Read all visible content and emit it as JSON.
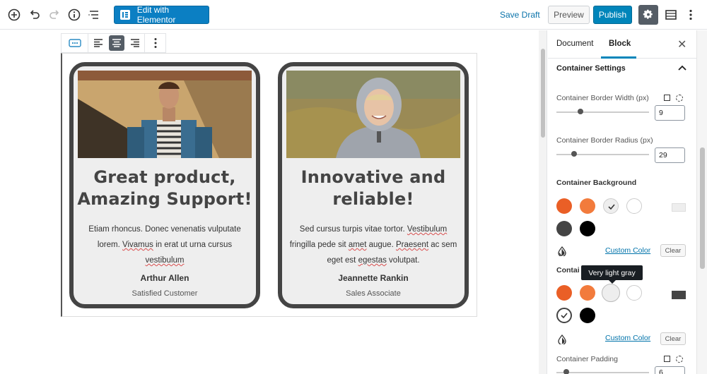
{
  "toolbar": {
    "elementor_label": "Edit with Elementor",
    "save_draft": "Save Draft",
    "preview": "Preview",
    "publish": "Publish"
  },
  "cards": [
    {
      "title_line1": "Great product,",
      "title_line2": "Amazing Support!",
      "body_line1": "Etiam rhoncus. Donec venenatis vulputate",
      "body_line2_pre": "lorem. ",
      "body_line2_spell": "Vivamus",
      "body_line2_post": " in erat ut urna cursus",
      "body_line3": "vestibulum",
      "name": "Arthur Allen",
      "role": "Satisfied Customer"
    },
    {
      "title_line1": "Innovative and",
      "title_line2": "reliable!",
      "body_line1_pre": "Sed cursus turpis vitae tortor. ",
      "body_line1_spell": "Vestibulum",
      "body_line2_pre": "fringilla pede sit ",
      "body_line2_spell1": "amet",
      "body_line2_mid": " augue. ",
      "body_line2_spell2": "Praesent",
      "body_line2_post": " ac sem",
      "body_line3_pre": "eget est ",
      "body_line3_spell": "egestas",
      "body_line3_post": " volutpat.",
      "name": "Jeannette Rankin",
      "role": "Sales Associate"
    }
  ],
  "sidebar": {
    "tabs": [
      "Document",
      "Block"
    ],
    "active_tab": "Block",
    "panel_title": "Container Settings",
    "border_width_label": "Container Border Width (px)",
    "border_width_value": "9",
    "border_radius_label": "Container Border Radius (px)",
    "border_radius_value": "29",
    "background_label": "Container Background",
    "background_custom": "Custom Color",
    "background_clear": "Clear",
    "border_color_label": "Contai",
    "border_color_custom": "Custom Color",
    "border_color_clear": "Clear",
    "padding_label": "Container Padding",
    "padding_value": "6",
    "tooltip": "Very light gray"
  },
  "colors": {
    "primary": "#0085ba",
    "elementor": "#0b7fc3",
    "card_border": "#444444",
    "card_bg": "#eeeeee",
    "swatch_orange_dark": "#ea5f26",
    "swatch_orange": "#f27b3c",
    "swatch_light_gray": "#eeeeee",
    "swatch_white": "#ffffff",
    "swatch_dark_gray": "#444444",
    "swatch_black": "#000000"
  },
  "icons": [
    "add-block-icon",
    "undo-icon",
    "redo-icon",
    "info-icon",
    "outline-icon",
    "gear-icon",
    "sidebar-toggle-icon",
    "more-menu-icon",
    "block-type-icon",
    "align-left-icon",
    "align-center-icon",
    "align-right-icon",
    "block-more-icon",
    "close-icon",
    "chevron-up-icon",
    "drop-icon"
  ]
}
